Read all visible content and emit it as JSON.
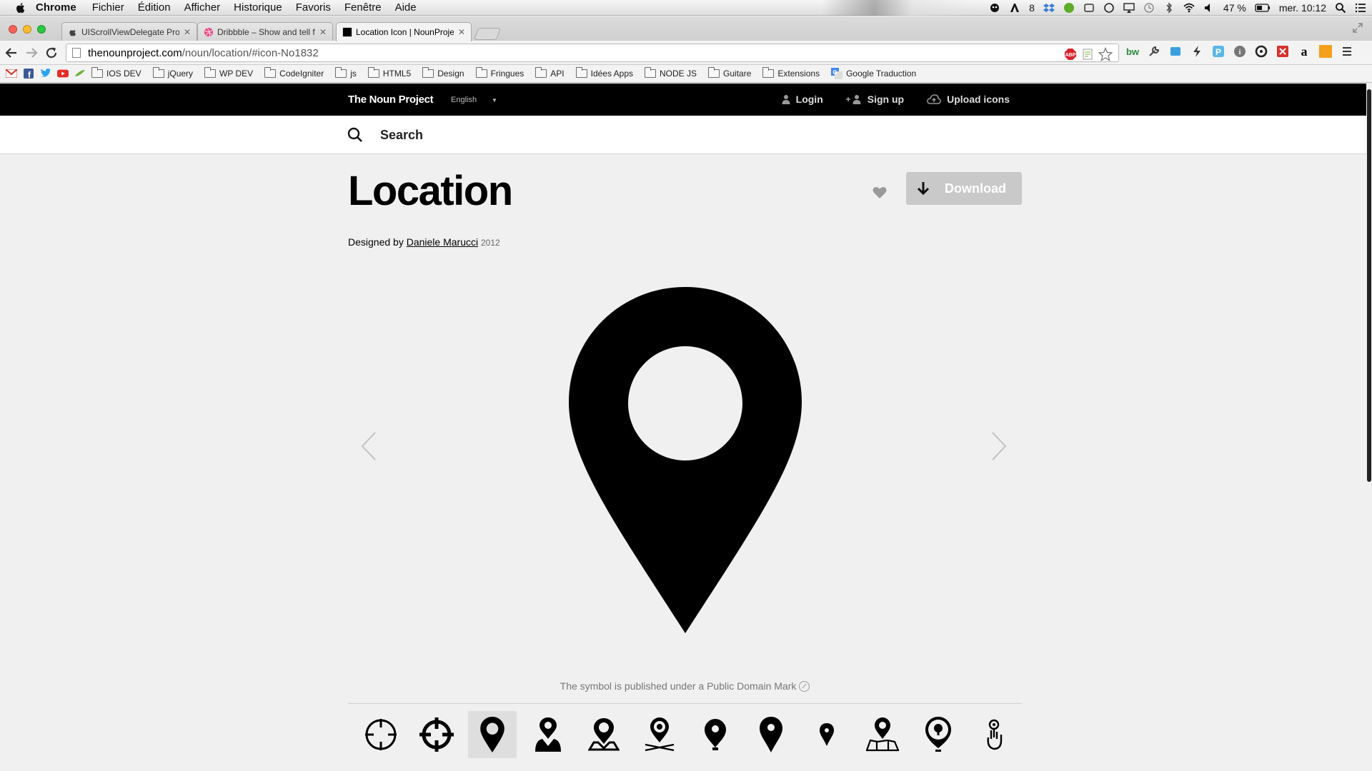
{
  "menubar": {
    "app_name": "Chrome",
    "items": [
      "Fichier",
      "Édition",
      "Afficher",
      "Historique",
      "Favoris",
      "Fenêtre",
      "Aide"
    ],
    "status": {
      "notifications": "8",
      "battery": "47 %",
      "clock": "mer. 10:12"
    }
  },
  "browser": {
    "tabs": [
      {
        "title": "UIScrollViewDelegate Proto",
        "favicon": "apple-icon"
      },
      {
        "title": "Dribbble – Show and tell fo",
        "favicon": "dribbble-icon"
      },
      {
        "title": "Location Icon | NounProjec",
        "favicon": "noun-project-icon",
        "active": true
      }
    ],
    "url": {
      "host": "thenounproject.com",
      "path": "/noun/location/#icon-No1832"
    },
    "bookmarks": [
      {
        "label": "IOS DEV",
        "type": "folder"
      },
      {
        "label": "jQuery",
        "type": "folder"
      },
      {
        "label": "WP DEV",
        "type": "folder"
      },
      {
        "label": "CodeIgniter",
        "type": "folder"
      },
      {
        "label": "js",
        "type": "folder"
      },
      {
        "label": "HTML5",
        "type": "folder"
      },
      {
        "label": "Design",
        "type": "folder"
      },
      {
        "label": "Fringues",
        "type": "folder"
      },
      {
        "label": "API",
        "type": "folder"
      },
      {
        "label": "Idées Apps",
        "type": "folder"
      },
      {
        "label": "NODE JS",
        "type": "folder"
      },
      {
        "label": "Guitare",
        "type": "folder"
      },
      {
        "label": "Extensions",
        "type": "folder"
      },
      {
        "label": "Google Traduction",
        "type": "link"
      }
    ],
    "colors": {
      "close": "#fc5f57",
      "minimize": "#fdbc2e",
      "maximize": "#28c840"
    }
  },
  "site": {
    "logo": "The Noun Project",
    "language": "English",
    "nav": {
      "login": "Login",
      "signup": "Sign up",
      "upload": "Upload icons"
    },
    "search_placeholder": "Search"
  },
  "icon_page": {
    "title": "Location",
    "designed_by_label": "Designed by",
    "designer": "Daniele Marucci",
    "year": "2012",
    "download_label": "Download",
    "license_text": "The symbol is published under a Public Domain Mark",
    "related_icons": [
      "crosshair-icon",
      "target-icon",
      "location-pin-icon",
      "person-pin-icon",
      "map-marker-icon",
      "marker-on-ground-icon",
      "pin-icon",
      "pin-icon",
      "small-pin-icon",
      "map-with-pin-icon",
      "pin-circle-icon",
      "hand-pointer-icon"
    ],
    "selected_related_index": 2
  }
}
